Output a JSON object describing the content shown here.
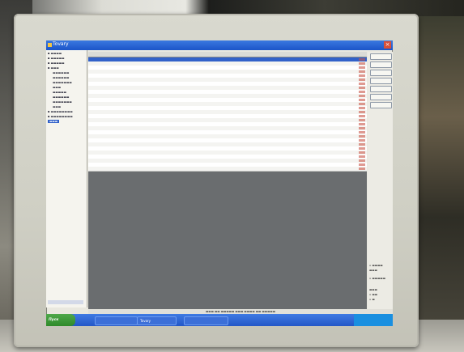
{
  "scene": "photo of a CRT/LCD monitor showing a Windows XP database application",
  "window": {
    "title": "Tovary"
  },
  "tree": {
    "items": [
      "",
      "",
      "",
      "",
      "",
      "",
      "",
      "",
      "",
      "",
      "",
      "",
      "",
      "",
      ""
    ],
    "selected_label": "Tovary"
  },
  "grid": {
    "row_count": 28
  },
  "right_panel": {
    "buttons": [
      "",
      "",
      "",
      "",
      "",
      "",
      ""
    ]
  },
  "taskbar": {
    "start_label": "Пуск",
    "buttons": [
      "",
      "Tovary",
      ""
    ]
  },
  "colors": {
    "titlebar": "#1c55c8",
    "taskbar": "#2457c7",
    "selection": "#3161c9",
    "grid_empty": "#6a6d6f",
    "row_accent_red": "#c9574a"
  }
}
